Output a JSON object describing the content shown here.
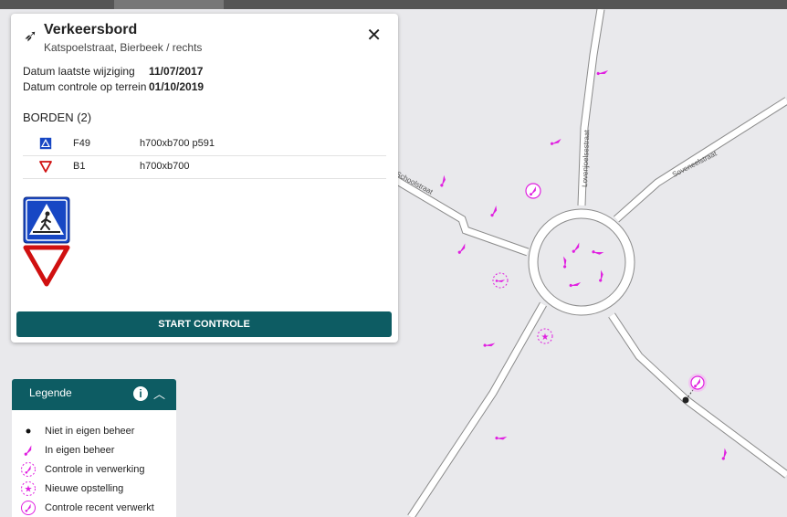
{
  "panel": {
    "title": "Verkeersbord",
    "subtitle": "Katspoelstraat, Bierbeek / rechts",
    "close_icon": "close-icon",
    "header_icon": "sign-pin-icon",
    "meta": [
      {
        "label": "Datum laatste wijziging",
        "value": "11/07/2017"
      },
      {
        "label": "Datum controle op terrein",
        "value": "01/10/2019"
      }
    ],
    "signs_heading": "BORDEN (2)",
    "signs": [
      {
        "code": "F49",
        "dims": "h700xb700 p591",
        "icon": "pedestrian-crossing-sign-icon"
      },
      {
        "code": "B1",
        "dims": "h700xb700",
        "icon": "yield-sign-icon"
      }
    ],
    "start_button": "START CONTROLE"
  },
  "legend": {
    "title": "Legende",
    "info_icon": "info-icon",
    "collapse_icon": "chevron-up-icon",
    "items": [
      {
        "label": "Niet in eigen beheer",
        "icon": "black-dot-icon"
      },
      {
        "label": "In eigen beheer",
        "icon": "magenta-sign-icon"
      },
      {
        "label": "Controle in verwerking",
        "icon": "dashed-circle-sign-icon"
      },
      {
        "label": "Nieuwe opstelling",
        "icon": "dashed-circle-star-icon"
      },
      {
        "label": "Controle recent verwerkt",
        "icon": "circle-sign-icon"
      }
    ]
  },
  "map": {
    "streets": [
      {
        "name": "Schoolstraat"
      },
      {
        "name": "Lovenjoelsestraat"
      },
      {
        "name": "Soveneelstraat"
      }
    ]
  },
  "colors": {
    "accent": "#0d5c63",
    "marker": "#e020e0",
    "map_bg": "#e9e9ec",
    "road_outline": "#8a8a8a"
  }
}
